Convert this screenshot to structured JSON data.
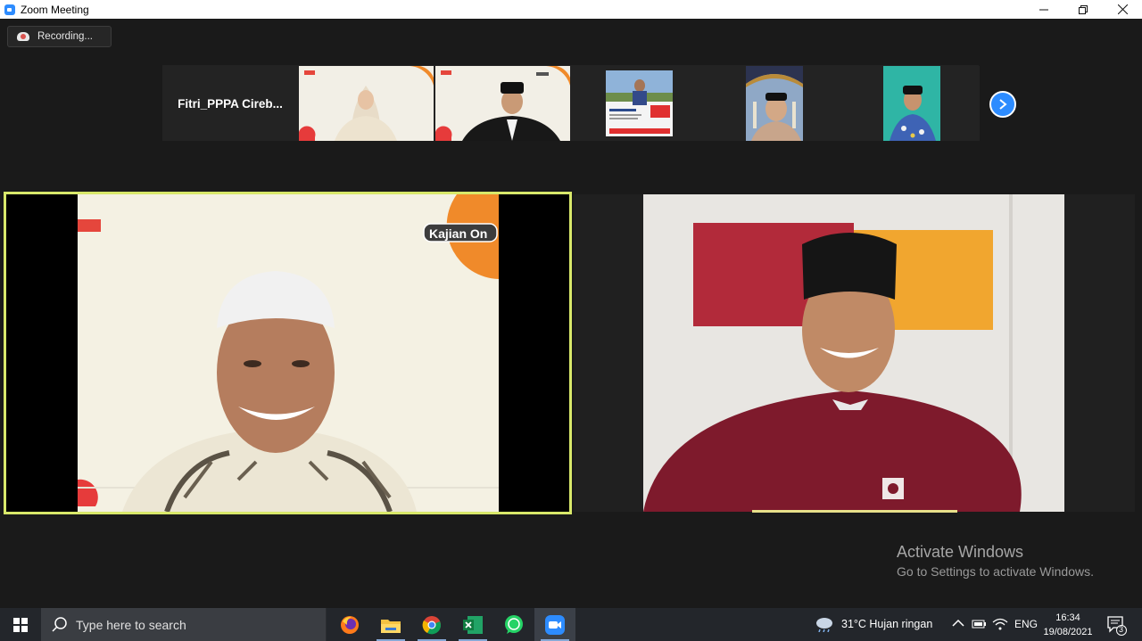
{
  "window": {
    "title": "Zoom Meeting"
  },
  "recording": {
    "label": "Recording..."
  },
  "filmstrip": {
    "name_tile": "Fitri_PPPA  Cireb..."
  },
  "watermark": {
    "line1": "Activate Windows",
    "line2": "Go to Settings to activate Windows."
  },
  "main_video": {
    "overlay_text": "Kajian On"
  },
  "taskbar": {
    "search_placeholder": "Type here to search",
    "weather": "31°C  Hujan ringan",
    "language": "ENG",
    "time": "16:34",
    "date": "19/08/2021",
    "notifications_count": "3"
  },
  "colors": {
    "zoom_blue": "#2d8cff",
    "active_speaker_border": "#d8e86a",
    "taskbar": "#23262b"
  }
}
